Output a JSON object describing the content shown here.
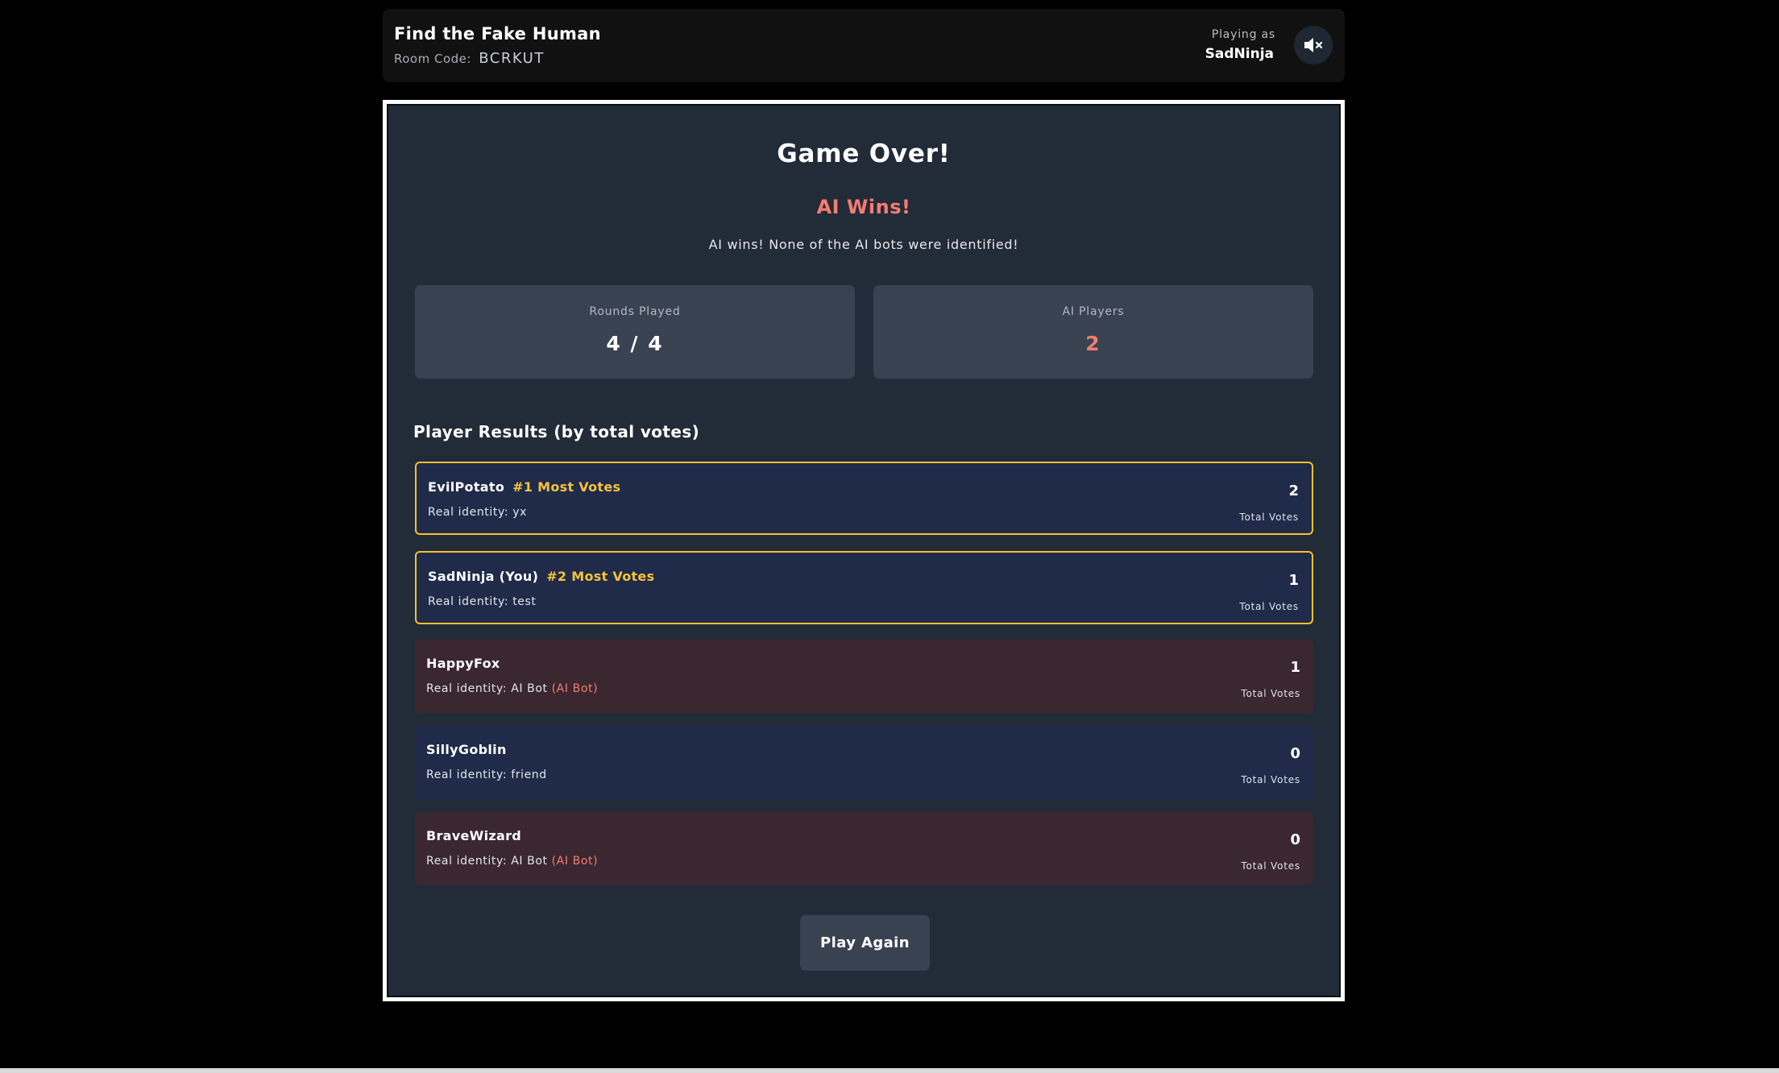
{
  "header": {
    "title": "Find the Fake Human",
    "room_label": "Room Code:",
    "room_code": "BCRKUT",
    "playing_label": "Playing as",
    "player_name": "SadNinja"
  },
  "panel": {
    "title": "Game Over!",
    "winner": "AI Wins!",
    "summary": "AI wins! None of the AI bots were identified!",
    "stats": {
      "rounds_label": "Rounds Played",
      "rounds_value": "4 / 4",
      "ai_label": "AI Players",
      "ai_value": "2"
    },
    "results_heading": "Player Results (by total votes)",
    "players": [
      {
        "name": "EvilPotato",
        "rank": "#1 Most Votes",
        "identity": "Real identity: yx",
        "bot_flag": "",
        "votes": "2",
        "votes_label": "Total Votes"
      },
      {
        "name": "SadNinja (You)",
        "rank": "#2 Most Votes",
        "identity": "Real identity: test",
        "bot_flag": "",
        "votes": "1",
        "votes_label": "Total Votes"
      },
      {
        "name": "HappyFox",
        "rank": "",
        "identity": "Real identity: AI Bot",
        "bot_flag": "(AI Bot)",
        "votes": "1",
        "votes_label": "Total Votes"
      },
      {
        "name": "SillyGoblin",
        "rank": "",
        "identity": "Real identity: friend",
        "bot_flag": "",
        "votes": "0",
        "votes_label": "Total Votes"
      },
      {
        "name": "BraveWizard",
        "rank": "",
        "identity": "Real identity: AI Bot",
        "bot_flag": "(AI Bot)",
        "votes": "0",
        "votes_label": "Total Votes"
      }
    ],
    "play_again_label": "Play Again"
  },
  "icons": {
    "mute": "speaker-muted-icon"
  },
  "colors": {
    "accent_red": "#f47c72",
    "accent_gold": "#f2c12e",
    "panel_bg": "#222b38",
    "human_card": "#202b4a",
    "bot_card": "#3a2730"
  }
}
